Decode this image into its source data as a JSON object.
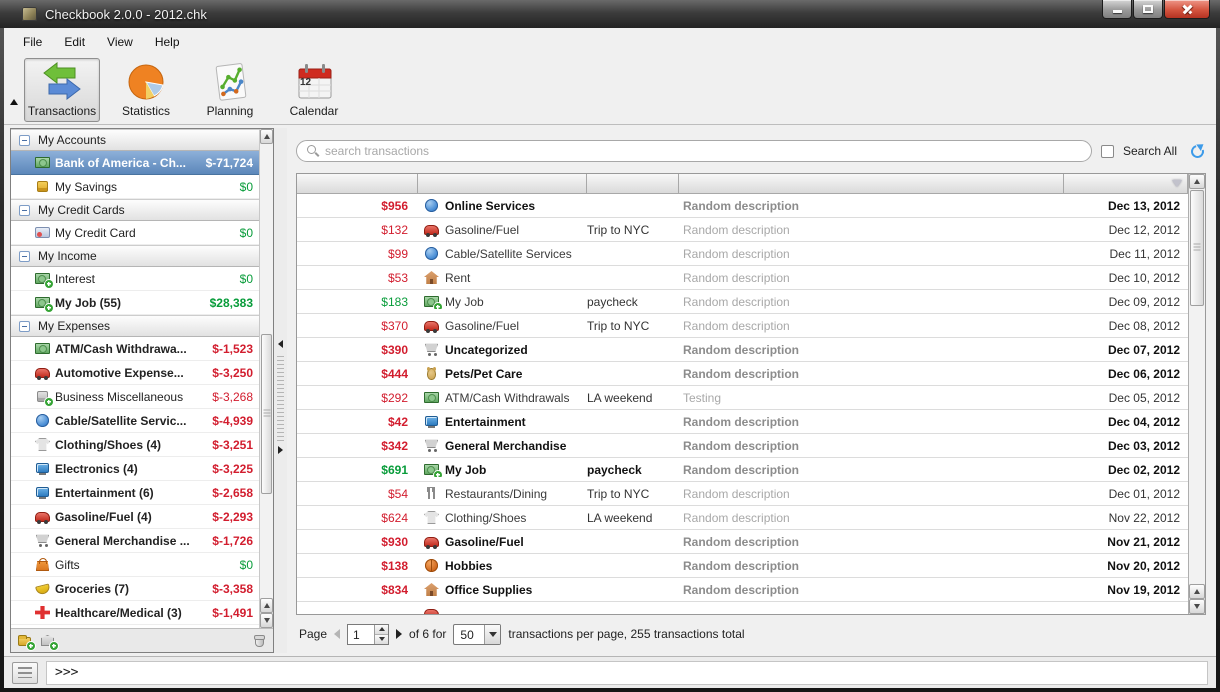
{
  "window": {
    "title": "Checkbook 2.0.0 - 2012.chk"
  },
  "menu": {
    "items": [
      "File",
      "Edit",
      "View",
      "Help"
    ]
  },
  "toolbar": {
    "buttons": [
      {
        "label": "Transactions",
        "active": true
      },
      {
        "label": "Statistics",
        "active": false
      },
      {
        "label": "Planning",
        "active": false
      },
      {
        "label": "Calendar",
        "active": false
      }
    ],
    "calendar_day": "12"
  },
  "sidebar": {
    "sections": [
      {
        "title": "My Accounts",
        "items": [
          {
            "icon": "money-bill",
            "label": "Bank of America - Ch...",
            "amount": "$-71,724",
            "amount_color": "white",
            "bold": true,
            "selected": true
          },
          {
            "icon": "coins",
            "label": "My Savings",
            "amount": "$0",
            "amount_color": "green",
            "bold": false,
            "selected": false
          }
        ]
      },
      {
        "title": "My Credit Cards",
        "items": [
          {
            "icon": "credit-card",
            "label": "My Credit Card",
            "amount": "$0",
            "amount_color": "green",
            "bold": false,
            "selected": false
          }
        ]
      },
      {
        "title": "My Income",
        "items": [
          {
            "icon": "money-plus",
            "label": "Interest",
            "amount": "$0",
            "amount_color": "green",
            "bold": false,
            "selected": false
          },
          {
            "icon": "money-plus",
            "label": "My Job (55)",
            "amount": "$28,383",
            "amount_color": "green",
            "bold": true,
            "selected": false
          }
        ]
      },
      {
        "title": "My Expenses",
        "items": [
          {
            "icon": "money-bill",
            "label": "ATM/Cash Withdrawa...",
            "amount": "$-1,523",
            "amount_color": "red",
            "bold": true,
            "selected": false
          },
          {
            "icon": "car",
            "label": "Automotive Expense...",
            "amount": "$-3,250",
            "amount_color": "red",
            "bold": true,
            "selected": false
          },
          {
            "icon": "coins-plus",
            "label": "Business Miscellaneous",
            "amount": "$-3,268",
            "amount_color": "red",
            "bold": false,
            "selected": false
          },
          {
            "icon": "globe",
            "label": "Cable/Satellite Servic...",
            "amount": "$-4,939",
            "amount_color": "red",
            "bold": true,
            "selected": false
          },
          {
            "icon": "shirt",
            "label": "Clothing/Shoes (4)",
            "amount": "$-3,251",
            "amount_color": "red",
            "bold": true,
            "selected": false
          },
          {
            "icon": "tv",
            "label": "Electronics (4)",
            "amount": "$-3,225",
            "amount_color": "red",
            "bold": true,
            "selected": false
          },
          {
            "icon": "tv",
            "label": "Entertainment (6)",
            "amount": "$-2,658",
            "amount_color": "red",
            "bold": true,
            "selected": false
          },
          {
            "icon": "car",
            "label": "Gasoline/Fuel (4)",
            "amount": "$-2,293",
            "amount_color": "red",
            "bold": true,
            "selected": false
          },
          {
            "icon": "cart",
            "label": "General Merchandise ...",
            "amount": "$-1,726",
            "amount_color": "red",
            "bold": true,
            "selected": false
          },
          {
            "icon": "gift",
            "label": "Gifts",
            "amount": "$0",
            "amount_color": "green",
            "bold": false,
            "selected": false
          },
          {
            "icon": "bananas",
            "label": "Groceries (7)",
            "amount": "$-3,358",
            "amount_color": "red",
            "bold": true,
            "selected": false
          },
          {
            "icon": "medical",
            "label": "Healthcare/Medical (3)",
            "amount": "$-1,491",
            "amount_color": "red",
            "bold": true,
            "selected": false
          }
        ]
      }
    ]
  },
  "search": {
    "placeholder": "search transactions",
    "search_all_label": "Search All",
    "search_all_checked": false
  },
  "table": {
    "rows": [
      {
        "amount": "$956",
        "amount_color": "red",
        "bold": true,
        "icon": "globe",
        "category": "Online Services",
        "tag": "",
        "description": "Random description",
        "date": "Dec 13, 2012"
      },
      {
        "amount": "$132",
        "amount_color": "red",
        "bold": false,
        "icon": "car",
        "category": "Gasoline/Fuel",
        "tag": "Trip to NYC",
        "description": "Random description",
        "date": "Dec 12, 2012"
      },
      {
        "amount": "$99",
        "amount_color": "red",
        "bold": false,
        "icon": "globe",
        "category": "Cable/Satellite Services",
        "tag": "",
        "description": "Random description",
        "date": "Dec 11, 2012"
      },
      {
        "amount": "$53",
        "amount_color": "red",
        "bold": false,
        "icon": "house",
        "category": "Rent",
        "tag": "",
        "description": "Random description",
        "date": "Dec 10, 2012"
      },
      {
        "amount": "$183",
        "amount_color": "green",
        "bold": false,
        "icon": "money-plus",
        "category": "My Job",
        "tag": "paycheck",
        "description": "Random description",
        "date": "Dec 09, 2012"
      },
      {
        "amount": "$370",
        "amount_color": "red",
        "bold": false,
        "icon": "car",
        "category": "Gasoline/Fuel",
        "tag": "Trip to NYC",
        "description": "Random description",
        "date": "Dec 08, 2012"
      },
      {
        "amount": "$390",
        "amount_color": "red",
        "bold": true,
        "icon": "cart",
        "category": "Uncategorized",
        "tag": "",
        "description": "Random description",
        "date": "Dec 07, 2012"
      },
      {
        "amount": "$444",
        "amount_color": "red",
        "bold": true,
        "icon": "pet",
        "category": "Pets/Pet Care",
        "tag": "",
        "description": "Random description",
        "date": "Dec 06, 2012"
      },
      {
        "amount": "$292",
        "amount_color": "red",
        "bold": false,
        "icon": "money-bill",
        "category": "ATM/Cash Withdrawals",
        "tag": "LA weekend",
        "description": "Testing",
        "date": "Dec 05, 2012"
      },
      {
        "amount": "$42",
        "amount_color": "red",
        "bold": true,
        "icon": "tv",
        "category": "Entertainment",
        "tag": "",
        "description": "Random description",
        "date": "Dec 04, 2012"
      },
      {
        "amount": "$342",
        "amount_color": "red",
        "bold": true,
        "icon": "cart",
        "category": "General Merchandise",
        "tag": "",
        "description": "Random description",
        "date": "Dec 03, 2012"
      },
      {
        "amount": "$691",
        "amount_color": "green",
        "bold": true,
        "icon": "money-plus",
        "category": "My Job",
        "tag": "paycheck",
        "description": "Random description",
        "date": "Dec 02, 2012"
      },
      {
        "amount": "$54",
        "amount_color": "red",
        "bold": false,
        "icon": "cutlery",
        "category": "Restaurants/Dining",
        "tag": "Trip to NYC",
        "description": "Random description",
        "date": "Dec 01, 2012"
      },
      {
        "amount": "$624",
        "amount_color": "red",
        "bold": false,
        "icon": "shirt",
        "category": "Clothing/Shoes",
        "tag": "LA weekend",
        "description": "Random description",
        "date": "Nov 22, 2012"
      },
      {
        "amount": "$930",
        "amount_color": "red",
        "bold": true,
        "icon": "car",
        "category": "Gasoline/Fuel",
        "tag": "",
        "description": "Random description",
        "date": "Nov 21, 2012"
      },
      {
        "amount": "$138",
        "amount_color": "red",
        "bold": true,
        "icon": "basketball",
        "category": "Hobbies",
        "tag": "",
        "description": "Random description",
        "date": "Nov 20, 2012"
      },
      {
        "amount": "$834",
        "amount_color": "red",
        "bold": true,
        "icon": "house",
        "category": "Office Supplies",
        "tag": "",
        "description": "Random description",
        "date": "Nov 19, 2012"
      },
      {
        "amount": "",
        "amount_color": "red",
        "bold": false,
        "icon": "car",
        "category": "",
        "tag": "",
        "description": "",
        "date": ""
      }
    ]
  },
  "pagination": {
    "label_page": "Page",
    "current_page": "1",
    "label_of": "of 6 for",
    "per_page": "50",
    "label_suffix": "transactions per page, 255 transactions total"
  },
  "console": {
    "prompt": ">>>"
  },
  "icons": {
    "search": "magnifier",
    "refresh": "circular-arrow",
    "filter": "triangle-down",
    "add_category": "folder-plus",
    "add_account": "bank-plus",
    "delete": "trash-can"
  },
  "colors": {
    "negative": "#d21d2e",
    "positive": "#089c3a",
    "selection": "#6591c5",
    "titlebar": "#3c3c3c"
  }
}
